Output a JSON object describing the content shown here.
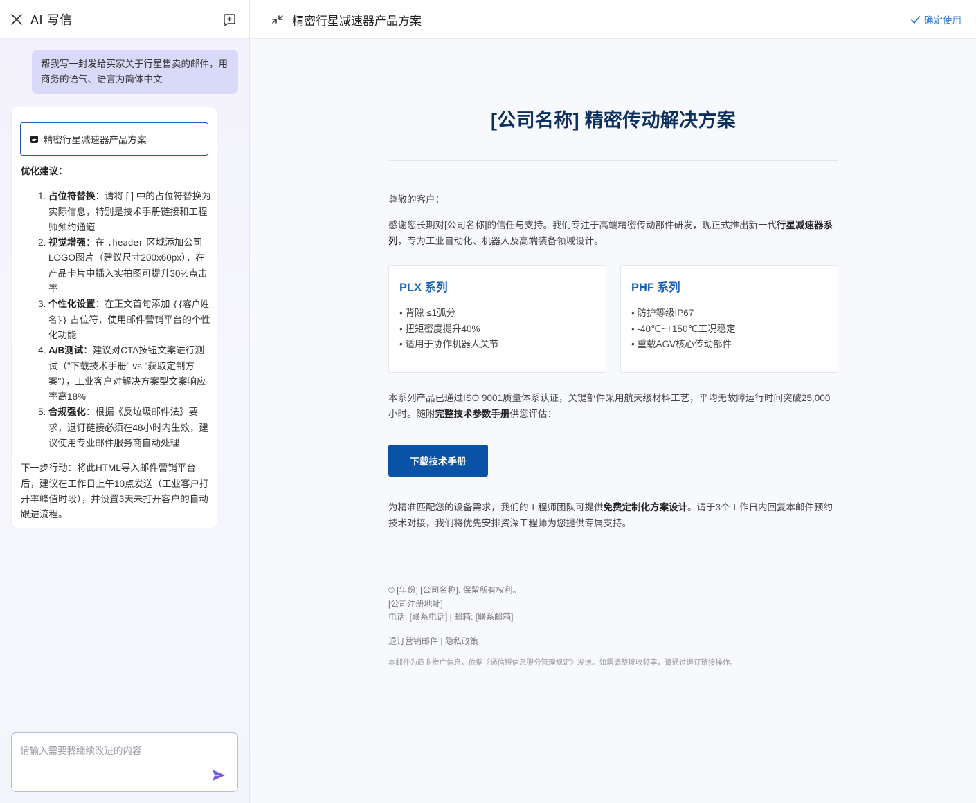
{
  "left_panel": {
    "title": "AI 写信",
    "user_message": "帮我写一封发给买家关于行星售卖的邮件，用商务的语气、语言为简体中文",
    "doc_chip": "精密行星减速器产品方案",
    "suggestions_heading": "优化建议：",
    "suggestions": [
      {
        "title": "占位符替换",
        "pre": "：请将 [ ] 中的占位符替换为实际信息，特别是技术手册链接和工程师预约通道",
        "code": "",
        "post": ""
      },
      {
        "title": "视觉增强",
        "pre": "：在 ",
        "code": ".header",
        "post": " 区域添加公司LOGO图片（建议尺寸200x60px），在产品卡片中插入实拍图可提升30%点击率"
      },
      {
        "title": "个性化设置",
        "pre": "：在正文首句添加 ",
        "code": "{{客户姓名}}",
        "post": " 占位符，使用邮件营销平台的个性化功能"
      },
      {
        "title": "A/B测试",
        "pre": "：建议对CTA按钮文案进行测试（\"下载技术手册\" vs \"获取定制方案\"），工业客户对解决方案型文案响应率高18%",
        "code": "",
        "post": ""
      },
      {
        "title": "合规强化",
        "pre": "：根据《反垃圾邮件法》要求，退订链接必须在48小时内生效，建议使用专业邮件服务商自动处理",
        "code": "",
        "post": ""
      }
    ],
    "next_steps": "下一步行动：将此HTML导入邮件营销平台后，建议在工作日上午10点发送（工业客户打开率峰值时段），并设置3天未打开客户的自动跟进流程。",
    "input_placeholder": "请输入需要我继续改进的内容"
  },
  "right_panel": {
    "doc_title": "精密行星减速器产品方案",
    "confirm_label": "确定使用",
    "email": {
      "title": "[公司名称] 精密传动解决方案",
      "greeting": "尊敬的客户：",
      "intro_pre": "感谢您长期对[公司名称]的信任与支持。我们专注于高端精密传动部件研发，现正式推出新一代",
      "intro_bold": "行星减速器系列",
      "intro_post": "，专为工业自动化、机器人及高端装备领域设计。",
      "products": [
        {
          "name": "PLX 系列",
          "features": [
            "背隙 ≤1弧分",
            "扭矩密度提升40%",
            "适用于协作机器人关节"
          ]
        },
        {
          "name": "PHF 系列",
          "features": [
            "防护等级IP67",
            "-40℃~+150℃工况稳定",
            "重载AGV核心传动部件"
          ]
        }
      ],
      "cert_pre": "本系列产品已通过ISO 9001质量体系认证，关键部件采用航天级材料工艺，平均无故障运行时间突破25,000小时。随附",
      "cert_bold": "完整技术参数手册",
      "cert_post": "供您评估：",
      "cta_label": "下载技术手册",
      "service_pre": "为精准匹配您的设备需求，我们的工程师团队可提供",
      "service_bold": "免费定制化方案设计",
      "service_post": "。请于3个工作日内回复本邮件预约技术对接，我们将优先安排资深工程师为您提供专属支持。",
      "footer_lines": [
        "© [年份] [公司名称]. 保留所有权利。",
        "[公司注册地址]",
        "电话: [联系电话] | 邮箱: [联系邮箱]"
      ],
      "unsubscribe_label": "退订营销邮件",
      "link_separator": " | ",
      "privacy_label": "隐私政策",
      "footer_note": "本邮件为商业推广信息，依据《通信短信息服务管理规定》发送。如需调整接收频率，请通过退订链接操作。"
    }
  },
  "colors": {
    "accent": "#0a52a5",
    "title": "#0b2f5e",
    "card_title": "#1a62b8",
    "confirm": "#2f7ad3",
    "user_bubble": "#d9dafa",
    "send_icon": "#7b4de8"
  },
  "icons": [
    "close-icon",
    "new-chat-icon",
    "document-icon",
    "send-icon",
    "collapse-icon",
    "check-icon"
  ]
}
